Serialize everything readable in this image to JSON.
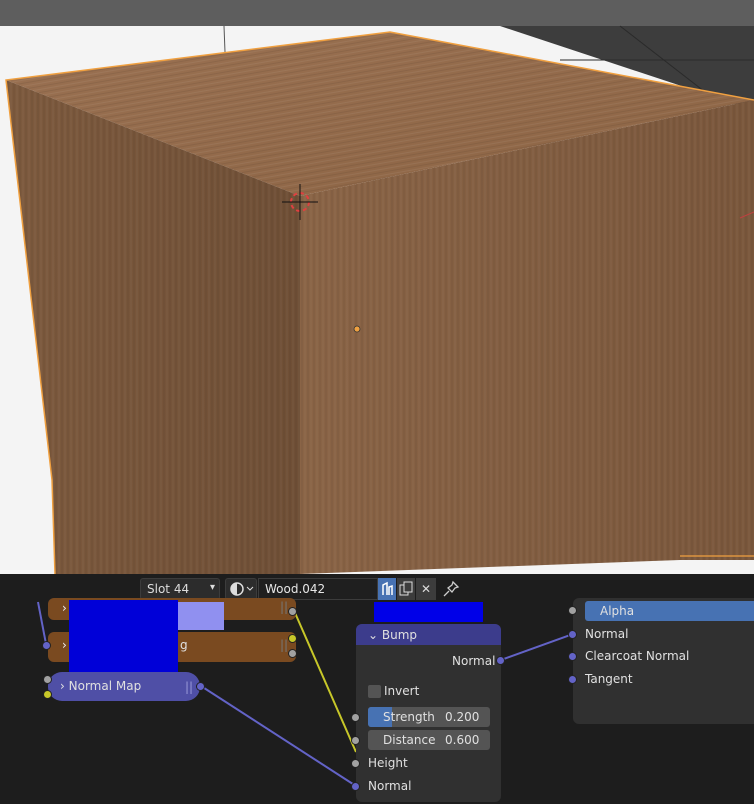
{
  "header": {
    "slot": "Slot 44",
    "material_name": "Wood.042",
    "close_symbol": "✕"
  },
  "nodes": {
    "normal_map": {
      "title": "Normal Map",
      "color": "#4f4fa6"
    },
    "texture_frag_label": "g",
    "bump": {
      "title": "Bump",
      "output": "Normal",
      "invert_label": "Invert",
      "strength_label": "Strength",
      "strength_value": "0.200",
      "strength_level": 0.2,
      "distance_label": "Distance",
      "distance_value": "0.600",
      "height_label": "Height",
      "normal_label": "Normal",
      "color": "#3c3c8c"
    },
    "principled": {
      "alpha_label": "Alpha",
      "normal_label": "Normal",
      "clearcoat_normal_label": "Clearcoat Normal",
      "tangent_label": "Tangent"
    }
  },
  "colors": {
    "wood": "#8a6040",
    "selection_outline": "#f0a040",
    "accent_blue": "#4772b3",
    "vector_socket": "#6363c7"
  }
}
